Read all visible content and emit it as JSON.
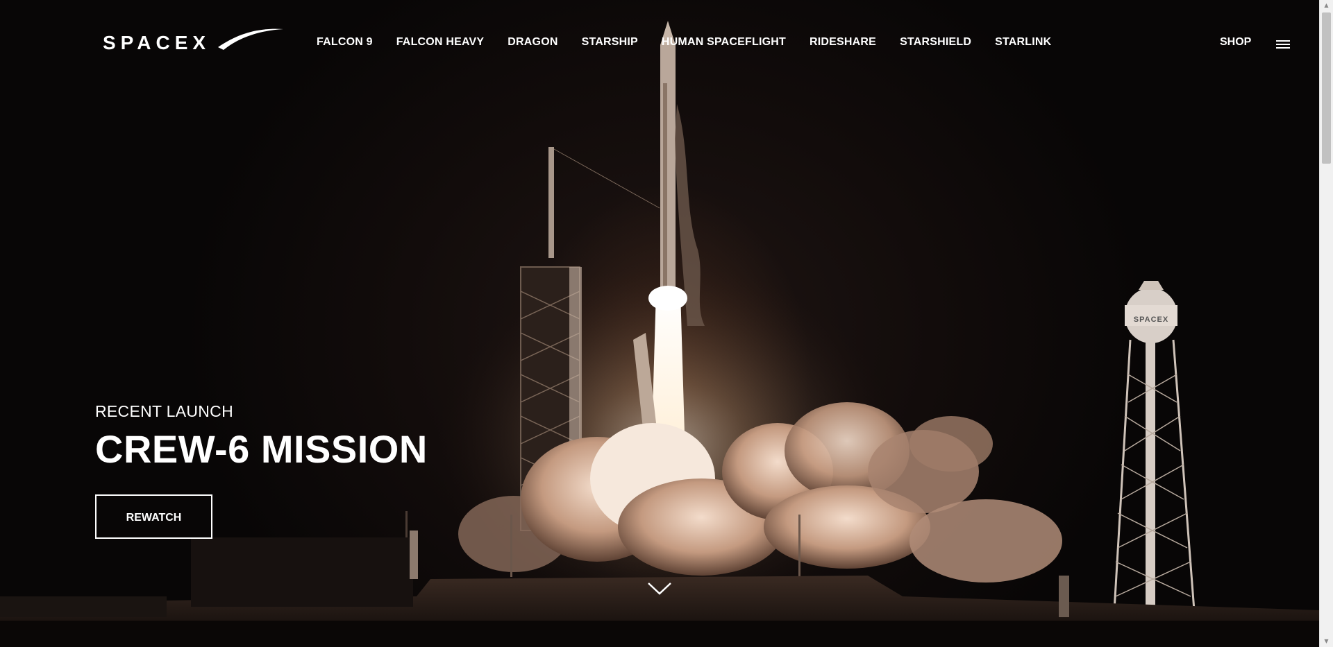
{
  "brand": {
    "logo_text": "SPACEX"
  },
  "nav": {
    "items": [
      {
        "label": "FALCON 9"
      },
      {
        "label": "FALCON HEAVY"
      },
      {
        "label": "DRAGON"
      },
      {
        "label": "STARSHIP"
      },
      {
        "label": "HUMAN SPACEFLIGHT"
      },
      {
        "label": "RIDESHARE"
      },
      {
        "label": "STARSHIELD"
      },
      {
        "label": "STARLINK"
      }
    ],
    "shop_label": "SHOP",
    "menu_icon": "hamburger-menu-icon"
  },
  "hero": {
    "eyebrow": "RECENT LAUNCH",
    "title": "CREW-6 MISSION",
    "cta_label": "REWATCH",
    "scroll_icon": "chevron-down-icon"
  },
  "scene": {
    "water_tower_text": "SPACEX"
  },
  "colors": {
    "background": "#0b0807",
    "text": "#ffffff",
    "flame": "#fff3de",
    "smoke": "#d9b9a4"
  }
}
